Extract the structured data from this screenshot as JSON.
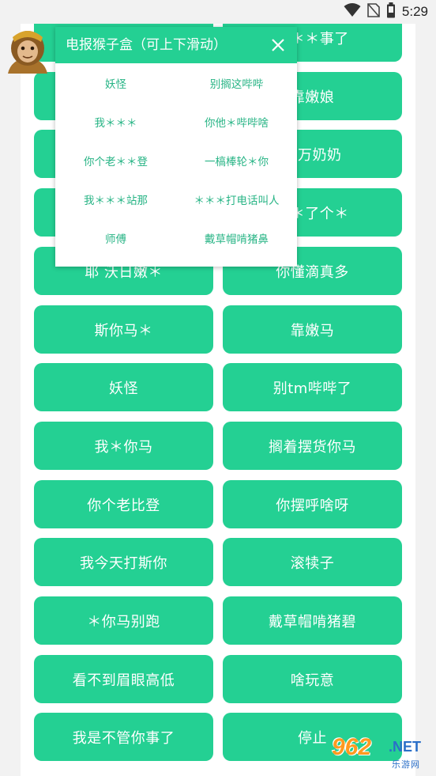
{
  "status_bar": {
    "time": "5:29",
    "icons": [
      "wifi-icon",
      "no-sim-icon",
      "battery-icon"
    ]
  },
  "grid": {
    "rows": [
      [
        "",
        "你＊＊事了"
      ],
      [
        "",
        "靠嫩娘"
      ],
      [
        "",
        "他万奶奶"
      ],
      [
        "",
        "你＊了个＊"
      ],
      [
        "耶 沃日嫩＊",
        "你懂滴真多"
      ],
      [
        "斯你马＊",
        "靠嫩马"
      ],
      [
        "妖怪",
        "别tm哔哔了"
      ],
      [
        "我＊你马",
        "搁着摆货你马"
      ],
      [
        "你个老比登",
        "你摆呼啥呀"
      ],
      [
        "我今天打斯你",
        "滚犊子"
      ],
      [
        "＊你马别跑",
        "戴草帽啃猪碧"
      ],
      [
        "看不到眉眼高低",
        "啥玩意"
      ],
      [
        "我是不管你事了",
        "停止"
      ]
    ]
  },
  "popup": {
    "title": "电报猴子盒（可上下滑动）",
    "close_icon": "close-icon",
    "items": [
      "妖怪",
      "别搁这哔哔",
      "我＊＊＊",
      "你他＊哔哔啥",
      "你个老＊＊登",
      "一槁棒轮＊你",
      "我＊＊＊站那",
      "＊＊＊打电话叫人",
      "师傅",
      "戴草帽啃猪鼻"
    ]
  },
  "watermark": {
    "number": "962",
    "net": ".NET",
    "sub": "乐游网"
  },
  "colors": {
    "accent": "#24d093",
    "popup_text": "#27b485",
    "background": "#f2f2f2",
    "card": "#ffffff"
  }
}
